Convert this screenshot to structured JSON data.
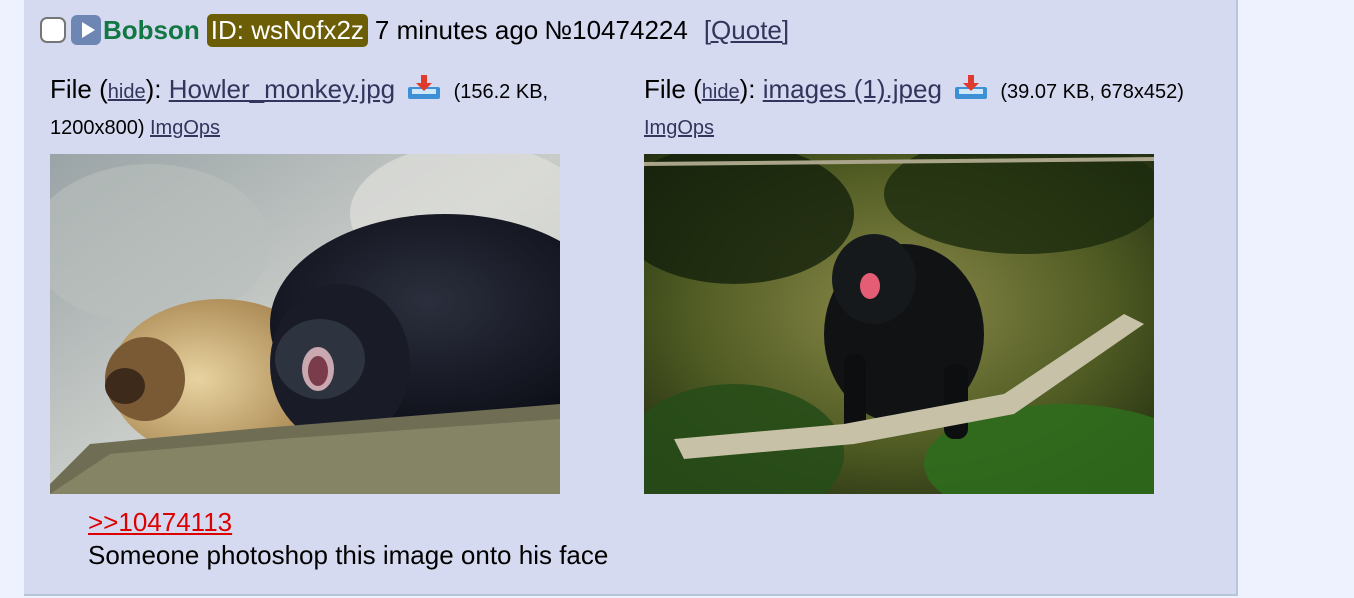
{
  "post": {
    "name": "Bobson",
    "id_label": "ID: wsNofx2z",
    "time": "7 minutes ago",
    "number": "№10474224",
    "quote": "[Quote]"
  },
  "files": [
    {
      "prefix": "File (",
      "hide": "hide",
      "sep": "):",
      "filename": "Howler_monkey.jpg",
      "meta_line1": "(156.2 KB,",
      "meta_line2": "1200x800)",
      "imgops": "ImgOps"
    },
    {
      "prefix": "File (",
      "hide": "hide",
      "sep": "):",
      "filename": "images (1).jpeg",
      "meta_line1": "(39.07 KB, 678x452)",
      "imgops": "ImgOps"
    }
  ],
  "reply": {
    "backlink": ">>10474113",
    "comment": "Someone photoshop this image onto his face"
  },
  "colors": {
    "post_bg": "#d6daf0",
    "name": "#117743",
    "id_badge": "#6b5e06",
    "link": "#34345c",
    "backlink": "#dd0000"
  },
  "icons": [
    "checkbox-icon",
    "menu-play-icon",
    "download-icon"
  ]
}
